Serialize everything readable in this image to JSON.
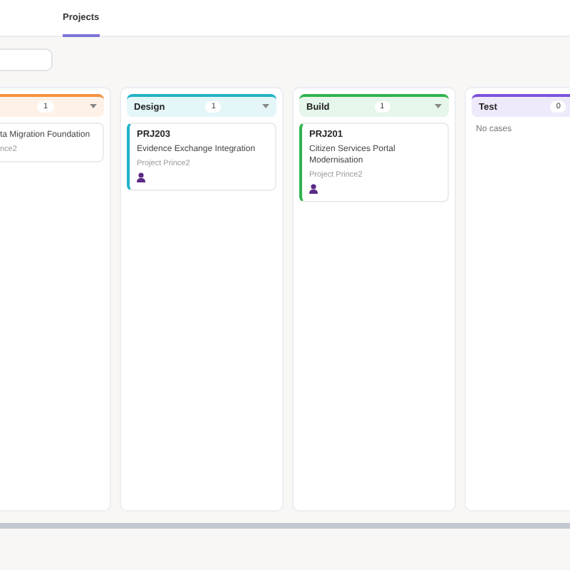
{
  "tabs": [
    {
      "label": "Projects",
      "selected": true
    }
  ],
  "columns": [
    {
      "count": "1",
      "color": "#f5923e",
      "cut": true,
      "cards": [
        {
          "title": "ta Migration Foundation",
          "project": "nce2",
          "owner": false
        }
      ]
    },
    {
      "name": "Design",
      "count": "1",
      "color": "#22b3c9",
      "cut": false,
      "cards": [
        {
          "id": "PRJ203",
          "title": "Evidence Exchange Integration",
          "project": "Project Prince2",
          "owner": true
        }
      ]
    },
    {
      "name": "Build",
      "count": "1",
      "color": "#2fb24f",
      "cut": false,
      "cards": [
        {
          "id": "PRJ201",
          "title": "Citizen Services Portal Modernisation",
          "project": "Project Prince2",
          "owner": true
        }
      ]
    },
    {
      "name": "Test",
      "count": "0",
      "color": "#7c52dc",
      "cut": false,
      "empty": "No cases"
    }
  ]
}
